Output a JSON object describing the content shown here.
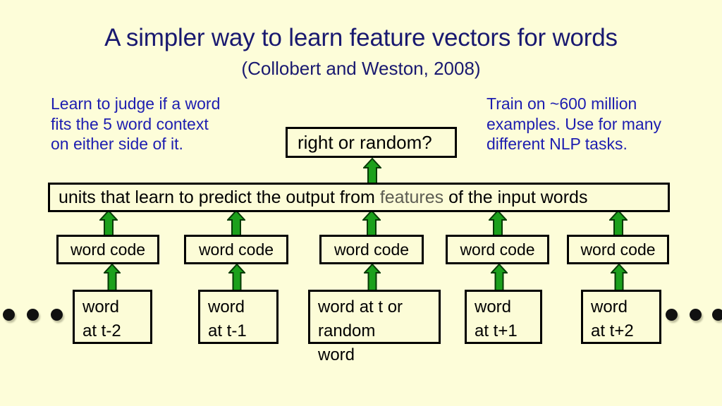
{
  "slide": {
    "background_color": "#fdfdd9",
    "title": "A simpler way to learn feature vectors for words",
    "subtitle": "(Collobert and Weston, 2008)",
    "title_color": "#191970"
  },
  "notes": {
    "left": {
      "color": "#1d1db0",
      "lines": [
        "Learn to judge if a word",
        "fits the 5 word context",
        "on either side of it."
      ]
    },
    "right": {
      "color": "#1d1db0",
      "lines": [
        "Train on ~600 million",
        "examples. Use for many",
        "different NLP tasks."
      ]
    }
  },
  "diagram": {
    "arrow_color": "#1ca01c",
    "arrow_outline_color": "#063a06",
    "box_border_color": "#000000",
    "box_fill_color": "#fcfcd7",
    "output_box": {
      "label": "right or random?"
    },
    "hidden_box": {
      "prefix": "units that learn to predict the output from ",
      "emphasis": "features",
      "emphasis_color": "#5c5c52",
      "suffix": " of the input words"
    },
    "code_boxes": [
      {
        "label": "word code"
      },
      {
        "label": "word code"
      },
      {
        "label": "word code"
      },
      {
        "label": "word code"
      },
      {
        "label": "word code"
      }
    ],
    "word_boxes": [
      {
        "line1": "word",
        "line2": "at t-2",
        "line3": ""
      },
      {
        "line1": "word",
        "line2": "at t-1",
        "line3": ""
      },
      {
        "line1": "word at t or",
        "line2": "random",
        "line3": "word"
      },
      {
        "line1": "word",
        "line2": "at t+1",
        "line3": ""
      },
      {
        "line1": "word",
        "line2": "at t+2",
        "line3": ""
      }
    ],
    "ellipsis_left_count": 3,
    "ellipsis_right_count": 3,
    "dot_color": "#111111"
  }
}
